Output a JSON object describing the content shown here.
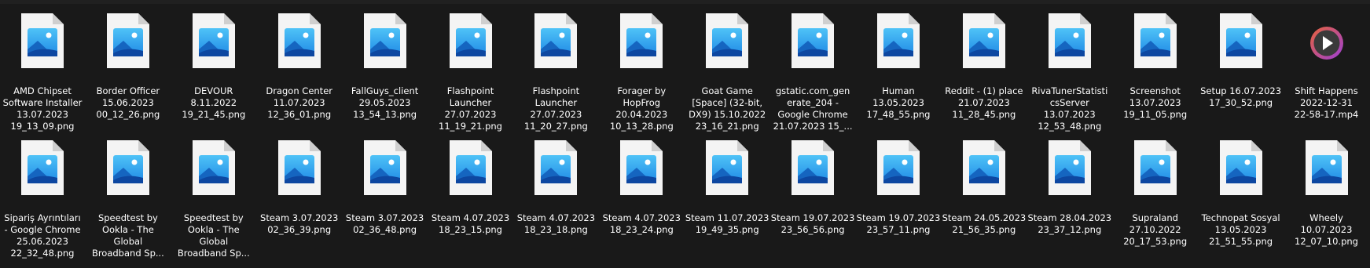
{
  "explorer": {
    "view": "large-icons",
    "files": [
      {
        "icon": "image-file-icon",
        "label": "AMD Chipset\nSoftware Installer\n13.07.2023\n19_13_09.png"
      },
      {
        "icon": "image-file-icon",
        "label": "Border Officer\n15.06.2023\n00_12_26.png"
      },
      {
        "icon": "image-file-icon",
        "label": "DEVOUR\n8.11.2022\n19_21_45.png"
      },
      {
        "icon": "image-file-icon",
        "label": "Dragon Center\n11.07.2023\n12_36_01.png"
      },
      {
        "icon": "image-file-icon",
        "label": "FallGuys_client\n29.05.2023\n13_54_13.png"
      },
      {
        "icon": "image-file-icon",
        "label": "Flashpoint\nLauncher\n27.07.2023\n11_19_21.png"
      },
      {
        "icon": "image-file-icon",
        "label": "Flashpoint\nLauncher\n27.07.2023\n11_20_27.png"
      },
      {
        "icon": "image-file-icon",
        "label": "Forager by\nHopFrog\n20.04.2023\n10_13_28.png"
      },
      {
        "icon": "image-file-icon",
        "label": "Goat Game\n[Space] (32-bit,\nDX9) 15.10.2022\n23_16_21.png"
      },
      {
        "icon": "image-file-icon",
        "label": "gstatic.com_gen\nerate_204 -\nGoogle Chrome\n21.07.2023 15_..."
      },
      {
        "icon": "image-file-icon",
        "label": "Human\n13.05.2023\n17_48_55.png"
      },
      {
        "icon": "image-file-icon",
        "label": "Reddit - (1) place\n21.07.2023\n11_28_45.png"
      },
      {
        "icon": "image-file-icon",
        "label": "RivaTunerStatisti\ncsServer\n13.07.2023\n12_53_48.png"
      },
      {
        "icon": "image-file-icon",
        "label": "Screenshot\n13.07.2023\n19_11_05.png"
      },
      {
        "icon": "image-file-icon",
        "label": "Setup 16.07.2023\n17_30_52.png"
      },
      {
        "icon": "video-file-icon",
        "label": "Shift Happens\n2022-12-31\n22-58-17.mp4"
      },
      {
        "icon": "image-file-icon",
        "label": "Sipariş Ayrıntıları\n- Google Chrome\n25.06.2023\n22_32_48.png"
      },
      {
        "icon": "image-file-icon",
        "label": "Speedtest by\nOokla - The\nGlobal\nBroadband Sp..."
      },
      {
        "icon": "image-file-icon",
        "label": "Speedtest by\nOokla - The\nGlobal\nBroadband Sp..."
      },
      {
        "icon": "image-file-icon",
        "label": "Steam 3.07.2023\n02_36_39.png"
      },
      {
        "icon": "image-file-icon",
        "label": "Steam 3.07.2023\n02_36_48.png"
      },
      {
        "icon": "image-file-icon",
        "label": "Steam 4.07.2023\n18_23_15.png"
      },
      {
        "icon": "image-file-icon",
        "label": "Steam 4.07.2023\n18_23_18.png"
      },
      {
        "icon": "image-file-icon",
        "label": "Steam 4.07.2023\n18_23_24.png"
      },
      {
        "icon": "image-file-icon",
        "label": "Steam 11.07.2023\n19_49_35.png"
      },
      {
        "icon": "image-file-icon",
        "label": "Steam 19.07.2023\n23_56_56.png"
      },
      {
        "icon": "image-file-icon",
        "label": "Steam 19.07.2023\n23_57_11.png"
      },
      {
        "icon": "image-file-icon",
        "label": "Steam 24.05.2023\n21_56_35.png"
      },
      {
        "icon": "image-file-icon",
        "label": "Steam 28.04.2023\n23_37_12.png"
      },
      {
        "icon": "image-file-icon",
        "label": "Supraland\n27.10.2022\n20_17_53.png"
      },
      {
        "icon": "image-file-icon",
        "label": "Technopat Sosyal\n13.05.2023\n21_51_55.png"
      },
      {
        "icon": "image-file-icon",
        "label": "Wheely\n10.07.2023\n12_07_10.png"
      }
    ]
  },
  "colors": {
    "background": "#191919",
    "text": "#ffffff",
    "page": "#f4f4f4",
    "fold": "#cfcfcf",
    "image_sky_top": "#4fc3f7",
    "image_sky_bottom": "#1e88e5",
    "mountain_back": "#1565c0",
    "mountain_front": "#0d47a1",
    "sun": "#ffffff",
    "video_ring_a": "#e8633a",
    "video_ring_b": "#9c3fd6"
  }
}
